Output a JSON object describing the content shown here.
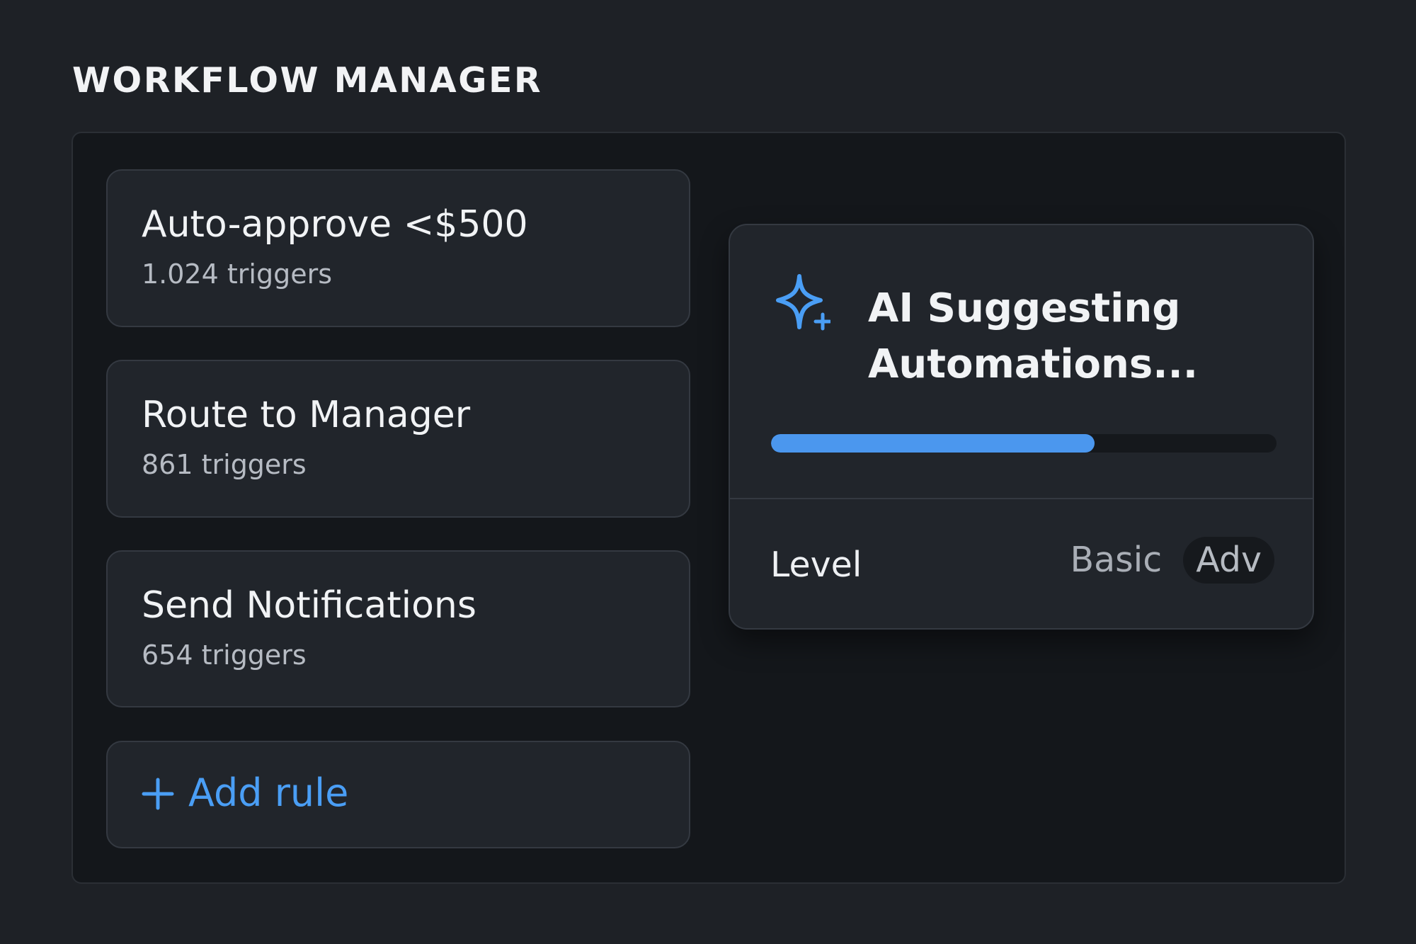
{
  "header": {
    "title": "WORKFLOW MANAGER"
  },
  "rules": [
    {
      "name": "Auto-approve <$500",
      "triggers": "1.024 triggers"
    },
    {
      "name": "Route to Manager",
      "triggers": "861 triggers"
    },
    {
      "name": "Send Notifications",
      "triggers": "654 triggers"
    }
  ],
  "add_rule": {
    "label": "Add rule",
    "icon": "plus-icon"
  },
  "ai_panel": {
    "icon": "sparkle-icon",
    "title": "AI Suggesting Automations...",
    "progress_fraction": 0.64,
    "level_label": "Level",
    "level_options": [
      "Basic",
      "Adv"
    ],
    "level_selected": "Adv"
  },
  "colors": {
    "accent": "#4a9ef5",
    "background": "#1e2126",
    "panel": "#14171b",
    "card": "#21252b"
  }
}
